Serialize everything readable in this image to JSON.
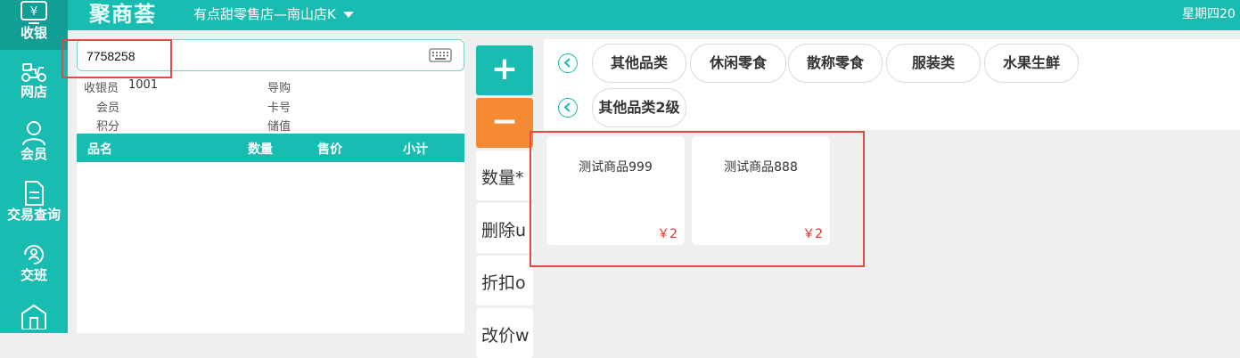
{
  "nav": {
    "items": [
      {
        "label": "收银",
        "icon": "cash-register-icon"
      },
      {
        "label": "网店",
        "icon": "scooter-icon"
      },
      {
        "label": "会员",
        "icon": "user-icon"
      },
      {
        "label": "交易查询",
        "icon": "document-icon"
      },
      {
        "label": "交班",
        "icon": "shift-handover-icon"
      },
      {
        "label": "",
        "icon": "store-icon"
      }
    ],
    "cash_symbol": "¥"
  },
  "header": {
    "logo": "聚商荟",
    "store": "有点甜零售店—南山店K",
    "weekday": "星期四20"
  },
  "search": {
    "value": "7758258"
  },
  "info": {
    "cashier_label": "收银员",
    "cashier_value": "1001",
    "guide_label": "导购",
    "member_label": "会员",
    "card_label": "卡号",
    "points_label": "积分",
    "balance_label": "储值"
  },
  "table": {
    "columns": [
      "品名",
      "数量",
      "售价",
      "小计"
    ]
  },
  "actions": {
    "plus": "+",
    "minus": "−",
    "buttons": [
      "数量*",
      "删除u",
      "折扣o",
      "改价w"
    ]
  },
  "categories": {
    "level1": [
      "其他品类",
      "休闲零食",
      "散称零食",
      "服装类",
      "水果生鲜"
    ],
    "level2": [
      "其他品类2级"
    ]
  },
  "products": [
    {
      "name": "测试商品999",
      "price": "￥2"
    },
    {
      "name": "测试商品888",
      "price": "￥2"
    }
  ],
  "colors": {
    "primary": "#18bcb1",
    "accent": "#f58a34",
    "price": "#e0322b",
    "highlight": "#e24a43"
  }
}
